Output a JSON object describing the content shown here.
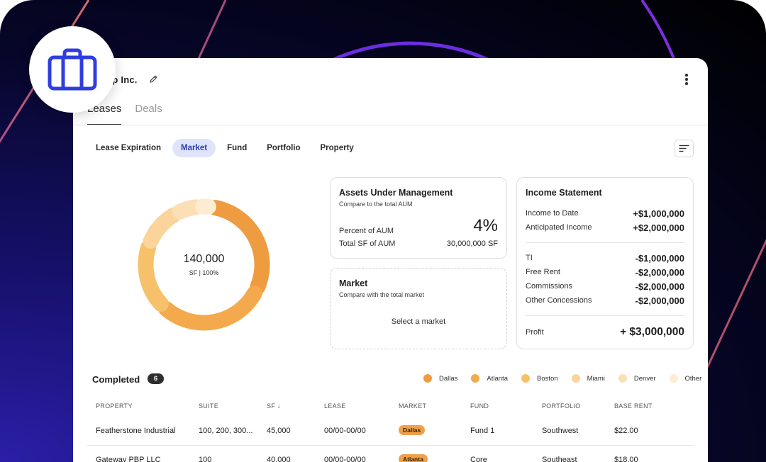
{
  "header": {
    "company": "ep Inc."
  },
  "tabs": [
    {
      "label": "Leases"
    },
    {
      "label": "Deals"
    }
  ],
  "filters": [
    {
      "label": "Lease Expiration"
    },
    {
      "label": "Market"
    },
    {
      "label": "Fund"
    },
    {
      "label": "Portfolio"
    },
    {
      "label": "Property"
    }
  ],
  "donut": {
    "value": "140,000",
    "caption": "SF | 100%",
    "segments": [
      {
        "fraction": 0.3,
        "color": "#ef9b3f"
      },
      {
        "fraction": 0.3,
        "color": "#f3a94c"
      },
      {
        "fraction": 0.185,
        "color": "#f7c06b"
      },
      {
        "fraction": 0.115,
        "color": "#fad49a"
      },
      {
        "fraction": 0.065,
        "color": "#fbdfb5"
      },
      {
        "fraction": 0.035,
        "color": "#fdecd2"
      }
    ]
  },
  "aum": {
    "title": "Assets Under Management",
    "subtitle": "Compare to the total AUM",
    "percent_label": "Percent of AUM",
    "percent_value": "4%",
    "total_label": "Total SF of AUM",
    "total_value": "30,000,000 SF"
  },
  "market": {
    "title": "Market",
    "subtitle": "Compare with the total market",
    "placeholder": "Select a market"
  },
  "income": {
    "title": "Income Statement",
    "rows_a": [
      {
        "label": "Income to Date",
        "value": "+$1,000,000"
      },
      {
        "label": "Anticipated Income",
        "value": "+$2,000,000"
      }
    ],
    "rows_b": [
      {
        "label": "TI",
        "value": "-$1,000,000"
      },
      {
        "label": "Free Rent",
        "value": "-$2,000,000"
      },
      {
        "label": "Commissions",
        "value": "-$2,000,000"
      },
      {
        "label": "Other Concessions",
        "value": "-$2,000,000"
      }
    ],
    "profit_label": "Profit",
    "profit_value": "+ $3,000,000"
  },
  "completed": {
    "label": "Completed",
    "count": "6"
  },
  "legend": [
    {
      "label": "Dallas",
      "color": "#ef9b3f"
    },
    {
      "label": "Atlanta",
      "color": "#f3a94c"
    },
    {
      "label": "Boston",
      "color": "#f7c06b"
    },
    {
      "label": "Miami",
      "color": "#fad49a"
    },
    {
      "label": "Denver",
      "color": "#fbdfb5"
    },
    {
      "label": "Other",
      "color": "#fdecd2"
    }
  ],
  "table": {
    "headers": [
      "PROPERTY",
      "SUITE",
      "SF",
      "LEASE",
      "MARKET",
      "FUND",
      "PORTFOLIO",
      "BASE RENT"
    ],
    "rows": [
      {
        "property": "Featherstone Industrial",
        "suite": "100, 200, 300...",
        "sf": "45,000",
        "lease": "00/00-00/00",
        "market": "Dallas",
        "fund": "Fund 1",
        "portfolio": "Southwest",
        "rent": "$22.00"
      },
      {
        "property": "Gateway PBP LLC",
        "suite": "100",
        "sf": "40,000",
        "lease": "00/00-00/00",
        "market": "Atlanta",
        "fund": "Core",
        "portfolio": "Southeast",
        "rent": "$18.00"
      }
    ]
  }
}
